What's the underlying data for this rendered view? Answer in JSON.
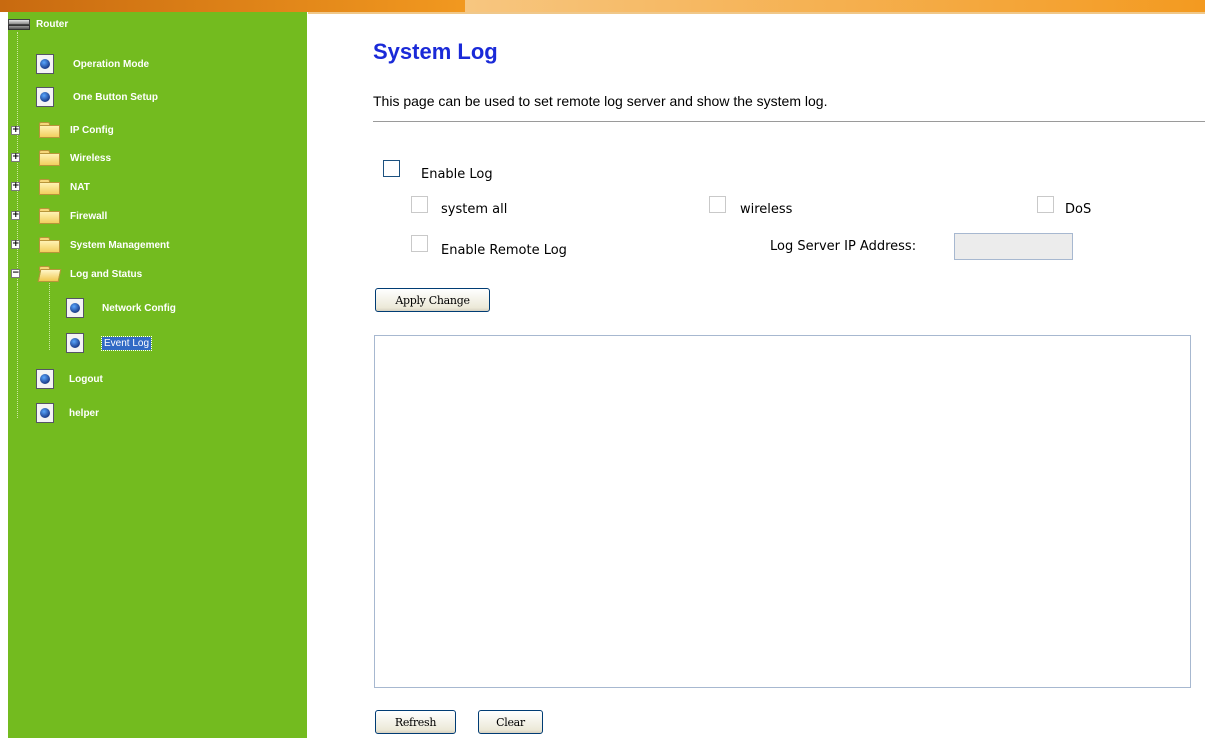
{
  "sidebar": {
    "root": "Router",
    "items": [
      {
        "label": "Operation Mode"
      },
      {
        "label": "One Button Setup"
      },
      {
        "label": "IP Config"
      },
      {
        "label": "Wireless"
      },
      {
        "label": "NAT"
      },
      {
        "label": "Firewall"
      },
      {
        "label": "System Management"
      },
      {
        "label": "Log and Status"
      },
      {
        "label": "Network Config"
      },
      {
        "label": "Event Log"
      },
      {
        "label": "Logout"
      },
      {
        "label": "helper"
      }
    ],
    "selected": "Event Log"
  },
  "page": {
    "title": "System Log",
    "description": "This page can be used to set remote log server and show the system log."
  },
  "form": {
    "enable_log": {
      "label": "Enable Log",
      "checked": false
    },
    "system_all": {
      "label": "system all",
      "checked": false
    },
    "wireless": {
      "label": "wireless",
      "checked": false
    },
    "dos": {
      "label": "DoS",
      "checked": false
    },
    "enable_remote_log": {
      "label": "Enable Remote Log",
      "checked": false
    },
    "log_server_ip_label": "Log Server IP Address:",
    "log_server_ip_value": ""
  },
  "buttons": {
    "apply": "Apply Change",
    "refresh": "Refresh",
    "clear": "Clear"
  },
  "log_text": ""
}
